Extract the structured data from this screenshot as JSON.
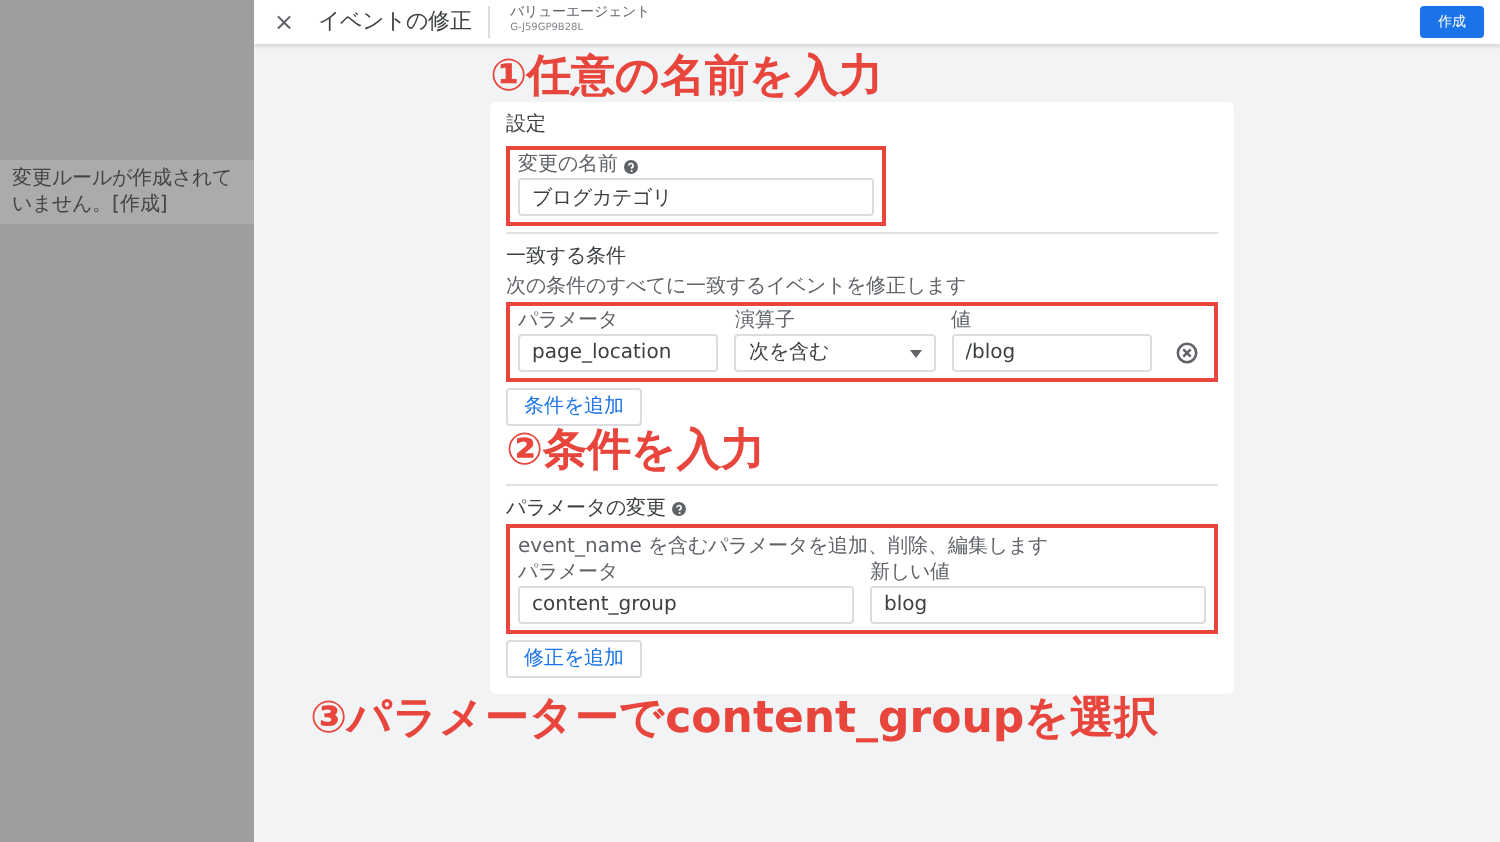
{
  "background": {
    "notice": "変更ルールが作成されていません。[作成]"
  },
  "header": {
    "close": "×",
    "title": "イベントの修正",
    "property_name": "バリューエージェント",
    "property_id": "G-J59GP9B28L",
    "create_button": "作成"
  },
  "settings_card": {
    "title": "設定",
    "name_field": {
      "label": "変更の名前",
      "value": "ブログカテゴリ"
    },
    "conditions": {
      "title": "一致する条件",
      "description": "次の条件のすべてに一致するイベントを修正します",
      "columns": [
        "パラメータ",
        "演算子",
        "値"
      ],
      "rows": [
        {
          "parameter": "page_location",
          "operator": "次を含む",
          "value": "/blog"
        }
      ],
      "add_button": "条件を追加"
    },
    "modifications": {
      "title": "パラメータの変更",
      "description": "event_name を含むパラメータを追加、削除、編集します",
      "columns": [
        "パラメータ",
        "新しい値"
      ],
      "rows": [
        {
          "parameter": "content_group",
          "new_value": "blog"
        }
      ],
      "add_button": "修正を追加"
    }
  },
  "annotations": [
    {
      "text": "①任意の名前を入力"
    },
    {
      "text": "②条件を入力"
    },
    {
      "text": "③パラメーターでcontent_groupを選択"
    }
  ]
}
